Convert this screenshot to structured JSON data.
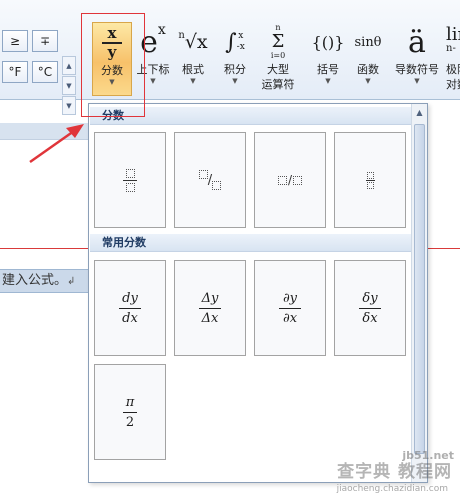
{
  "symbols": {
    "geq": "≥",
    "minus_plus": "∓",
    "fahrenheit": "°F",
    "celsius": "°C",
    "scroll_up": "▲",
    "scroll_down": "▼",
    "expand": "▼"
  },
  "ribbon": {
    "fraction": {
      "icon_top": "x",
      "icon_bottom": "y",
      "label": "分数"
    },
    "script": {
      "icon_base": "e",
      "icon_sup": "x",
      "label": "上下标"
    },
    "radical": {
      "icon_index": "n",
      "icon_radical": "√x",
      "label": "根式"
    },
    "integral": {
      "icon_upper": "x",
      "icon_lower": "-x",
      "icon_sign": "∫",
      "label": "积分"
    },
    "large_operator": {
      "icon_upper": "n",
      "icon_sign": "Σ",
      "icon_lower": "i=0",
      "label_line1": "大型",
      "label_line2": "运算符"
    },
    "bracket": {
      "icon": "{()}",
      "label": "括号"
    },
    "function": {
      "icon": "sinθ",
      "label": "函数"
    },
    "accent": {
      "icon": "ä",
      "label": "导数符号"
    },
    "limit": {
      "icon_top": "lin",
      "icon_bottom": "n-",
      "label_line1": "极阳",
      "label_line2": "对数"
    },
    "dropdown_arrow": "▼"
  },
  "gallery": {
    "section_fraction": "分数",
    "section_common": "常用分数",
    "common": [
      {
        "num": "dy",
        "den": "dx"
      },
      {
        "num": "Δy",
        "den": "Δx"
      },
      {
        "num": "∂y",
        "den": "∂x"
      },
      {
        "num": "δy",
        "den": "δx"
      },
      {
        "num": "π",
        "den": "2"
      }
    ],
    "skew_slash": "/",
    "linear_slash": "/",
    "scroll_up": "▲"
  },
  "document": {
    "field_text": "建入公式。",
    "field_tail": "↲"
  },
  "watermark": {
    "site": "jb51.net",
    "main": "查字典 教程网",
    "url": "jiaocheng.chazidian.com"
  }
}
